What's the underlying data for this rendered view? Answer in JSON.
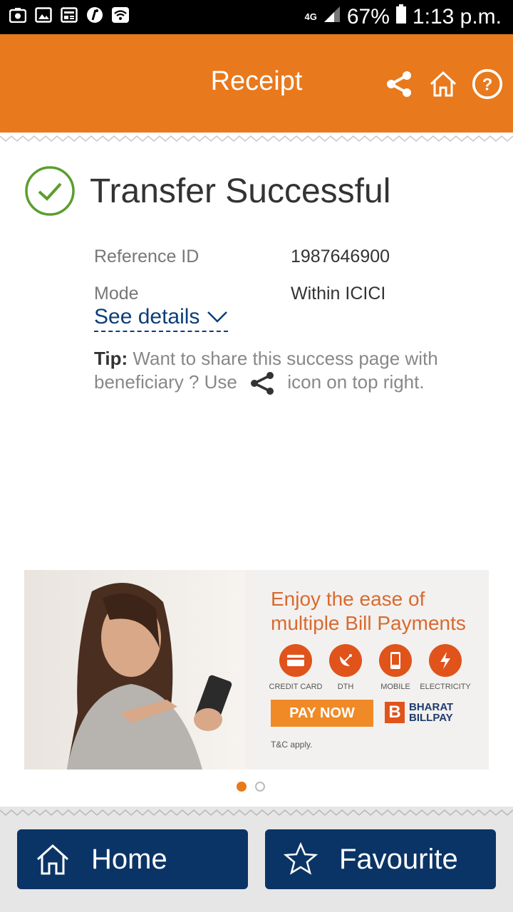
{
  "statusbar": {
    "network": "4G",
    "battery": "67%",
    "time": "1:13 p.m."
  },
  "appbar": {
    "title": "Receipt",
    "actions": [
      "share-icon",
      "home-icon",
      "help-icon"
    ]
  },
  "status": {
    "title": "Transfer Successful",
    "icon": "check-circle-icon",
    "color": "#5a9e2d"
  },
  "details": [
    {
      "label": "Reference ID",
      "value": "1987646900"
    },
    {
      "label": "Mode",
      "value": "Within ICICI"
    }
  ],
  "see_details": "See details",
  "tip": {
    "prefix": "Tip:",
    "text_before": " Want to share this success page with beneficiary ? Use",
    "text_after": " icon on top right."
  },
  "banner": {
    "headline_line1": "Enjoy the ease of",
    "headline_line2": "multiple Bill Payments",
    "services": [
      "CREDIT CARD",
      "DTH",
      "MOBILE",
      "ELECTRICITY"
    ],
    "cta": "PAY NOW",
    "brand_line1": "BHARAT",
    "brand_line2": "BILLPAY",
    "brand_letter": "B",
    "tnc": "T&C apply."
  },
  "carousel": {
    "active": 1,
    "total": 2
  },
  "bottom": {
    "home_label": "Home",
    "favourite_label": "Favourite"
  },
  "colors": {
    "brand": "#e8791d",
    "navy": "#0b3466",
    "link": "#0b3e7a"
  }
}
